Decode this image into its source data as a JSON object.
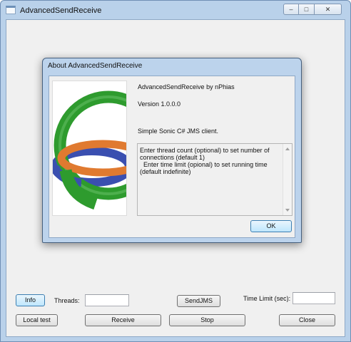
{
  "window": {
    "title": "AdvancedSendReceive",
    "caption": {
      "minimize": "–",
      "maximize": "□",
      "close": "✕"
    },
    "icon": "app-window-icon"
  },
  "about_dialog": {
    "title": "About AdvancedSendReceive",
    "product_line": "AdvancedSendReceive by nPhias",
    "version": "Version 1.0.0.0",
    "description": "Simple Sonic C# JMS client.",
    "details": "Enter thread count (optional) to set number of connections (default 1)\n  Enter time limit (opional) to set running time (default indefinite)",
    "ok_label": "OK",
    "logo": {
      "icon": "rings-logo-icon",
      "colors": {
        "green": "#2e9b2e",
        "orange": "#e07a30",
        "blue": "#3a4fb0",
        "dark_green": "#1f6b1f"
      }
    }
  },
  "main": {
    "info_label": "Info",
    "threads_label": "Threads:",
    "threads_value": "",
    "send_jms_label": "SendJMS",
    "time_limit_label": "Time Limit (sec):",
    "time_limit_value": "",
    "local_test_label": "Local test",
    "receive_label": "Receive",
    "stop_label": "Stop",
    "close_label": "Close"
  },
  "colors": {
    "frame": "#b9d1ea",
    "client": "#f0f0f0",
    "focus_border": "#3c7fb1"
  }
}
